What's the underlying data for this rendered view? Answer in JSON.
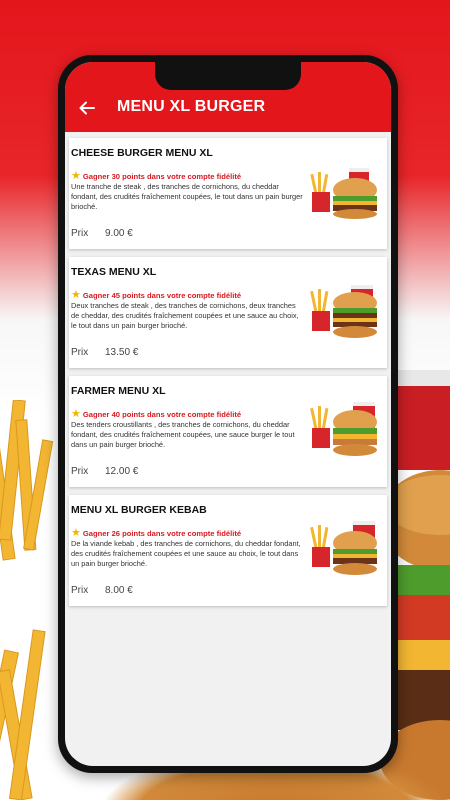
{
  "app_bar": {
    "back_icon": "arrow-left-icon",
    "title": "MENU XL BURGER",
    "color": "#e3161c"
  },
  "menu": {
    "price_label": "Prix",
    "items": [
      {
        "title": "CHEESE BURGER MENU XL",
        "points": "Gagner 30 points dans votre compte fidélité",
        "description": "Une tranche de steak , des tranches de cornichons, du cheddar fondant, des crudités fraîchement coupées, le tout dans un pain burger brioché.",
        "price": "9.00 €",
        "image_icon": "burger-menu-image"
      },
      {
        "title": "TEXAS MENU XL",
        "points": "Gagner 45 points dans votre compte fidélité",
        "description": "Deux tranches de steak , des tranches de cornichons, deux tranches de cheddar, des crudités fraîchement coupées et une sauce au choix, le tout dans un pain burger brioché.",
        "price": "13.50 €",
        "image_icon": "burger-menu-image"
      },
      {
        "title": "FARMER MENU XL",
        "points": "Gagner 40 points dans votre compte fidélité",
        "description": "Des tenders croustillants , des tranches de cornichons, du cheddar fondant, des crudités fraîchement coupées, une sauce burger le tout dans un pain burger brioché.",
        "price": "12.00 €",
        "image_icon": "burger-menu-image"
      },
      {
        "title": "MENU XL BURGER KEBAB",
        "points": "Gagner 26 points dans votre compte fidélité",
        "description": "De la viande kebab , des tranches de cornichons, du cheddar fondant, des crudités fraîchement coupées et une sauce au choix, le tout dans un pain burger brioché.",
        "price": "8.00 €",
        "image_icon": "burger-menu-image"
      }
    ]
  },
  "colors": {
    "accent": "#e3161c",
    "points_text": "#d71920",
    "star": "#f5b400"
  }
}
